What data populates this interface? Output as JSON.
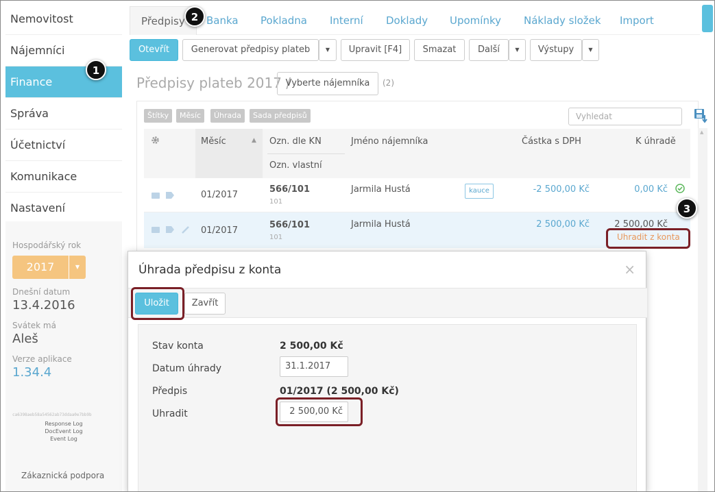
{
  "sidebar": {
    "items": [
      {
        "label": "Nemovitost"
      },
      {
        "label": "Nájemníci"
      },
      {
        "label": "Finance"
      },
      {
        "label": "Správa"
      },
      {
        "label": "Účetnictví"
      },
      {
        "label": "Komunikace"
      },
      {
        "label": "Nastavení"
      }
    ],
    "active_index": 2,
    "fiscal_year_label": "Hospodářský rok",
    "fiscal_year": "2017",
    "today_label": "Dnešní datum",
    "today": "13.4.2016",
    "name_day_label": "Svátek má",
    "name_day": "Aleš",
    "version_label": "Verze aplikace",
    "version": "1.34.4",
    "hash": "ca6398aeb58a54562ab73ddaa0e7bb9b",
    "logs": [
      "Response Log",
      "DocEvent Log",
      "Event Log"
    ],
    "support": "Zákaznická podpora"
  },
  "tabs": [
    "Předpisy",
    "Banka",
    "Pokladna",
    "Interní",
    "Doklady",
    "Upomínky",
    "Náklady složek",
    "Import"
  ],
  "toolbar": {
    "open": "Otevřít",
    "generate": "Generovat předpisy plateb",
    "edit": "Upravit [F4]",
    "delete": "Smazat",
    "more": "Další",
    "outputs": "Výstupy"
  },
  "page": {
    "title": "Předpisy plateb 2017 /",
    "select_tenant": "Vyberte nájemníka",
    "count": "(2)"
  },
  "filters": [
    "Štítky",
    "Měsíc",
    "Úhrada",
    "Sada předpisů"
  ],
  "search": {
    "placeholder": "Vyhledat"
  },
  "table": {
    "headers": {
      "month": "Měsíc",
      "kn": "Ozn. dle KN",
      "own": "Ozn. vlastní",
      "tenant": "Jméno nájemníka",
      "amount": "Částka s DPH",
      "to_pay": "K úhradě"
    },
    "rows": [
      {
        "month": "01/2017",
        "kn": "566/101",
        "own": "101",
        "tenant": "Jarmila Hustá",
        "badge": "kauce",
        "amount": "-2 500,00 Kč",
        "to_pay": "0,00 Kč"
      },
      {
        "month": "01/2017",
        "kn": "566/101",
        "own": "101",
        "tenant": "Jarmila Hustá",
        "badge": "",
        "amount": "2 500,00 Kč",
        "to_pay": "2 500,00 Kč",
        "action": "Uhradit z konta"
      }
    ]
  },
  "modal": {
    "title": "Úhrada předpisu z konta",
    "save": "Uložit",
    "close": "Zavřít",
    "account_label": "Stav konta",
    "account_value": "2 500,00 Kč",
    "date_label": "Datum úhrady",
    "date_value": "31.1.2017",
    "prescription_label": "Předpis",
    "prescription_value": "01/2017 (2 500,00 Kč)",
    "pay_label": "Uhradit",
    "pay_value": "2 500,00 Kč"
  },
  "annotations": [
    "1",
    "2",
    "3"
  ],
  "colors": {
    "accent": "#5bc0de",
    "link": "#5aa7cf",
    "year": "#f5c580",
    "highlight": "#7a1f26",
    "success": "#5cb85c",
    "warning": "#e8975a"
  }
}
